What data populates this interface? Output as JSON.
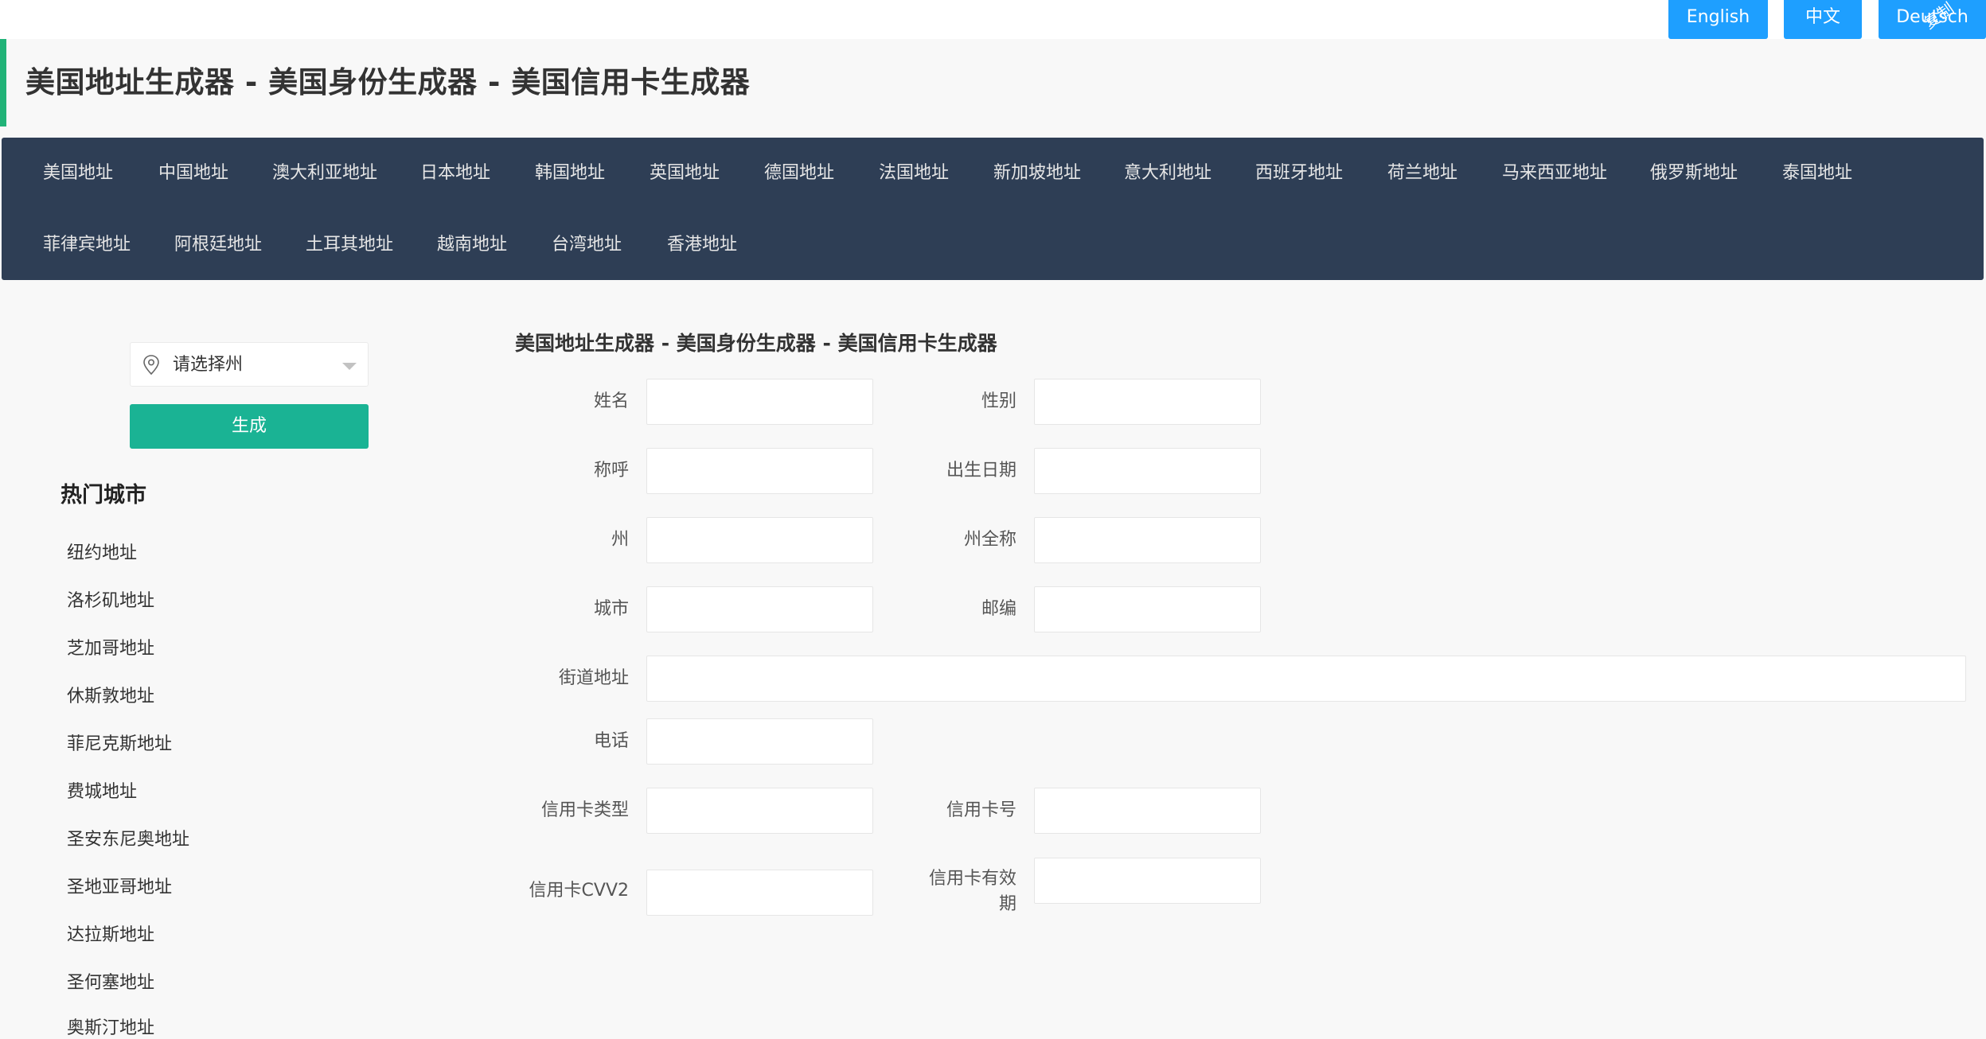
{
  "languages": {
    "english": "English",
    "chinese": "中文",
    "german": "Deutsch",
    "corner_mark": "复制"
  },
  "header": {
    "title": "美国地址生成器 - 美国身份生成器 - 美国信用卡生成器"
  },
  "nav": {
    "row1": [
      "美国地址",
      "中国地址",
      "澳大利亚地址",
      "日本地址",
      "韩国地址",
      "英国地址",
      "德国地址",
      "法国地址",
      "新加坡地址",
      "意大利地址",
      "西班牙地址",
      "荷兰地址",
      "马来西亚地址",
      "俄罗斯地址",
      "泰国地址"
    ],
    "row2": [
      "菲律宾地址",
      "阿根廷地址",
      "土耳其地址",
      "越南地址",
      "台湾地址",
      "香港地址"
    ]
  },
  "sidebar": {
    "state_select_placeholder": "请选择州",
    "generate_label": "生成",
    "hot_cities_title": "热门城市",
    "cities": [
      "纽约地址",
      "洛杉矶地址",
      "芝加哥地址",
      "休斯敦地址",
      "菲尼克斯地址",
      "费城地址",
      "圣安东尼奥地址",
      "圣地亚哥地址",
      "达拉斯地址",
      "圣何塞地址",
      "奥斯汀地址"
    ]
  },
  "form": {
    "title": "美国地址生成器 - 美国身份生成器 - 美国信用卡生成器",
    "labels": {
      "name": "姓名",
      "gender": "性别",
      "title": "称呼",
      "birthday": "出生日期",
      "state": "州",
      "state_full": "州全称",
      "city": "城市",
      "zip": "邮编",
      "street": "街道地址",
      "phone": "电话",
      "cc_type": "信用卡类型",
      "cc_number": "信用卡号",
      "cc_cvv": "信用卡CVV2",
      "cc_exp_line1": "信用卡有效",
      "cc_exp_line2": "期"
    },
    "values": {
      "name": "",
      "gender": "",
      "title": "",
      "birthday": "",
      "state": "",
      "state_full": "",
      "city": "",
      "zip": "",
      "street": "",
      "phone": "",
      "cc_type": "",
      "cc_number": "",
      "cc_cvv": "",
      "cc_exp": ""
    }
  },
  "colors": {
    "accent_blue": "#1e9fff",
    "accent_green": "#1ab394",
    "title_stripe": "#21b378",
    "nav_bg": "#2e3e55"
  }
}
